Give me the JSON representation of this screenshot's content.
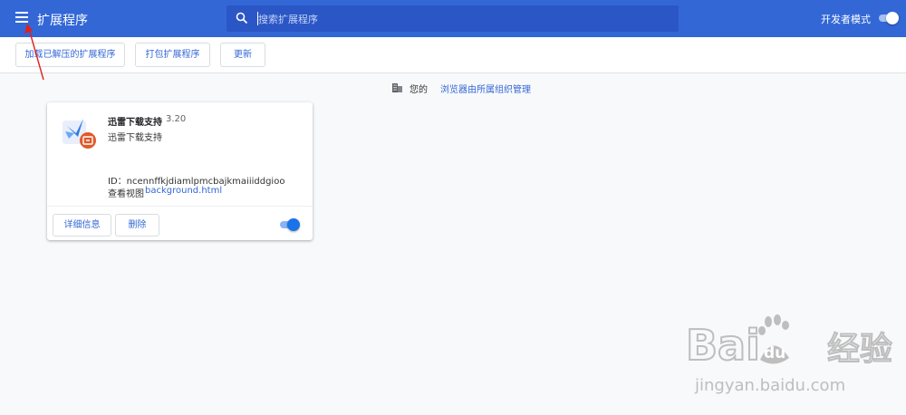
{
  "header": {
    "title": "扩展程序",
    "menu_icon": "hamburger-menu-icon",
    "search": {
      "placeholder": "搜索扩展程序",
      "icon": "search-icon"
    },
    "dev_mode": {
      "label": "开发者模式",
      "enabled": true
    }
  },
  "toolbar": {
    "load_unpacked": "加载已解压的扩展程序",
    "pack": "打包扩展程序",
    "update": "更新"
  },
  "managed_notice": {
    "icon": "building-icon",
    "prefix": "您的",
    "link": "浏览器由所属组织管理"
  },
  "extension": {
    "name": "迅雷下载支持",
    "version": "3.20",
    "description": "迅雷下载支持",
    "id_label": "ID：ncennffkjdiamlpmcbajkmaiiiddgioo",
    "views_label": "查看视图",
    "views_link": "background.html",
    "details_button": "详细信息",
    "remove_button": "删除",
    "enabled": true
  },
  "watermark": {
    "logo_text": "Baidu经验",
    "url": "jingyan.baidu.com"
  },
  "colors": {
    "header_bg": "#3367d6",
    "search_bg": "#2a56c6",
    "link": "#3367d6",
    "page_bg": "#f8f9fa",
    "annotation_arrow": "#e02020"
  }
}
